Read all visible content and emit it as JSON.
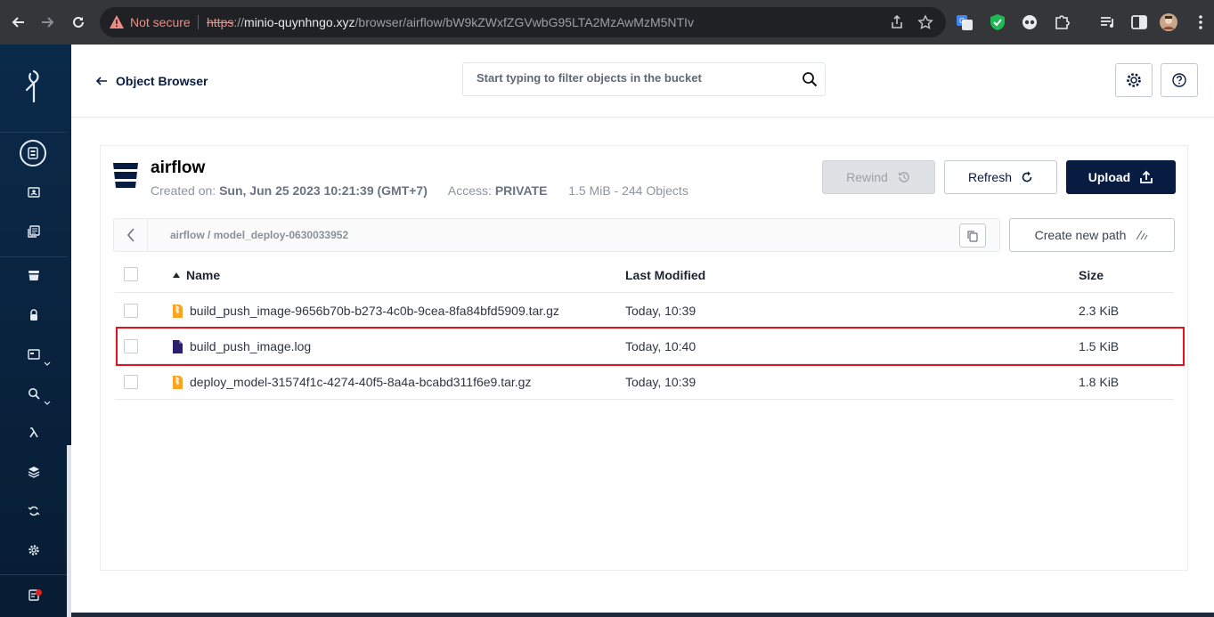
{
  "browser": {
    "security_label": "Not secure",
    "url_scheme": "https",
    "url_sep": "://",
    "url_host": "minio-quynhngo.xyz",
    "url_path": "/browser/airflow/bW9kZWxfZGVwbG95LTA2MzAwMzM5NTIv"
  },
  "sidebar": {
    "items": [
      {
        "icon": "buckets-icon",
        "active": true
      },
      {
        "icon": "identity-icon"
      },
      {
        "icon": "documents-icon"
      },
      {
        "icon": "bucket-icon"
      },
      {
        "icon": "lock-icon"
      },
      {
        "icon": "monitoring-icon"
      },
      {
        "icon": "search-icon"
      },
      {
        "icon": "lambda-icon"
      },
      {
        "icon": "layers-icon"
      },
      {
        "icon": "sync-icon"
      },
      {
        "icon": "gear-icon"
      },
      {
        "icon": "license-icon"
      }
    ]
  },
  "topbar": {
    "back_label": "Object Browser",
    "search_placeholder": "Start typing to filter objects in the bucket"
  },
  "bucket": {
    "name": "airflow",
    "created_label": "Created on:",
    "created_value": "Sun, Jun 25 2023 10:21:39 (GMT+7)",
    "access_label": "Access:",
    "access_value": "PRIVATE",
    "usage": "1.5 MiB - 244 Objects"
  },
  "actions": {
    "rewind": "Rewind",
    "refresh": "Refresh",
    "upload": "Upload",
    "create_path": "Create new path"
  },
  "breadcrumb": {
    "bucket": "airflow",
    "separator": "/",
    "folder": "model_deploy-0630033952"
  },
  "table": {
    "columns": {
      "name": "Name",
      "modified": "Last Modified",
      "size": "Size"
    },
    "rows": [
      {
        "name": "build_push_image-9656b70b-b273-4c0b-9cea-8fa84bfd5909.tar.gz",
        "modified": "Today, 10:39",
        "size": "2.3 KiB",
        "type": "archive"
      },
      {
        "name": "build_push_image.log",
        "modified": "Today, 10:40",
        "size": "1.5 KiB",
        "type": "document"
      },
      {
        "name": "deploy_model-31574f1c-4274-40f5-8a4a-bcabd311f6e9.tar.gz",
        "modified": "Today, 10:39",
        "size": "1.8 KiB",
        "type": "archive"
      }
    ]
  },
  "colors": {
    "navy": "#081c42",
    "archive_icon": "#f5a623",
    "document_icon": "#2a1f6b",
    "highlight": "#e3121e"
  }
}
